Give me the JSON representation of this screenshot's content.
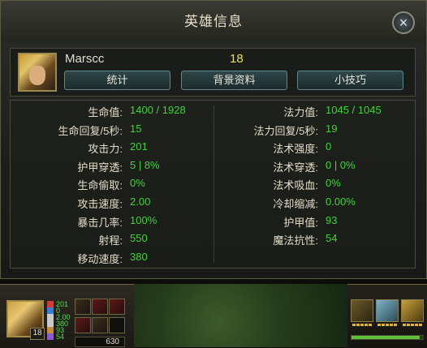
{
  "window": {
    "title": "英雄信息",
    "close_icon": "×"
  },
  "header": {
    "champion_name": "Marscc",
    "level": "18",
    "buttons": [
      "统计",
      "背景资料",
      "小技巧"
    ]
  },
  "stats_left": [
    {
      "label": "生命值:",
      "value": "1400 / 1928"
    },
    {
      "label": "生命回复/5秒:",
      "value": "15"
    },
    {
      "label": "攻击力:",
      "value": "201"
    },
    {
      "label": "护甲穿透:",
      "value": "5 | 8%"
    },
    {
      "label": "生命偷取:",
      "value": "0%"
    },
    {
      "label": "攻击速度:",
      "value": "2.00"
    },
    {
      "label": "暴击几率:",
      "value": "100%"
    },
    {
      "label": "射程:",
      "value": "550"
    },
    {
      "label": "移动速度:",
      "value": "380"
    }
  ],
  "stats_right": [
    {
      "label": "法力值:",
      "value": "1045 / 1045"
    },
    {
      "label": "法力回复/5秒:",
      "value": "19"
    },
    {
      "label": "法术强度:",
      "value": "0"
    },
    {
      "label": "法术穿透:",
      "value": "0 | 0%"
    },
    {
      "label": "法术吸血:",
      "value": "0%"
    },
    {
      "label": "冷却缩减:",
      "value": "0.00%"
    },
    {
      "label": "护甲值:",
      "value": "93"
    },
    {
      "label": "魔法抗性:",
      "value": "54"
    }
  ],
  "hud": {
    "level": "18",
    "mini_stats": [
      {
        "icon": "sword-icon",
        "color": "#d33b3b",
        "value": "201"
      },
      {
        "icon": "wand-icon",
        "color": "#3b7dd3",
        "value": "0"
      },
      {
        "icon": "boot-icon",
        "color": "#c9c9c9",
        "value": "2.00"
      },
      {
        "icon": "speed-icon",
        "color": "#c9c9c9",
        "value": "380"
      },
      {
        "icon": "shield-icon",
        "color": "#c98a3b",
        "value": "93"
      },
      {
        "icon": "magic-shield-icon",
        "color": "#8a5bd3",
        "value": "54"
      }
    ],
    "gold": "630",
    "xp_fraction": 0.95
  },
  "colors": {
    "stat_value": "#3fd33b",
    "level": "#e8e14c",
    "accent": "#5f8a8c"
  }
}
